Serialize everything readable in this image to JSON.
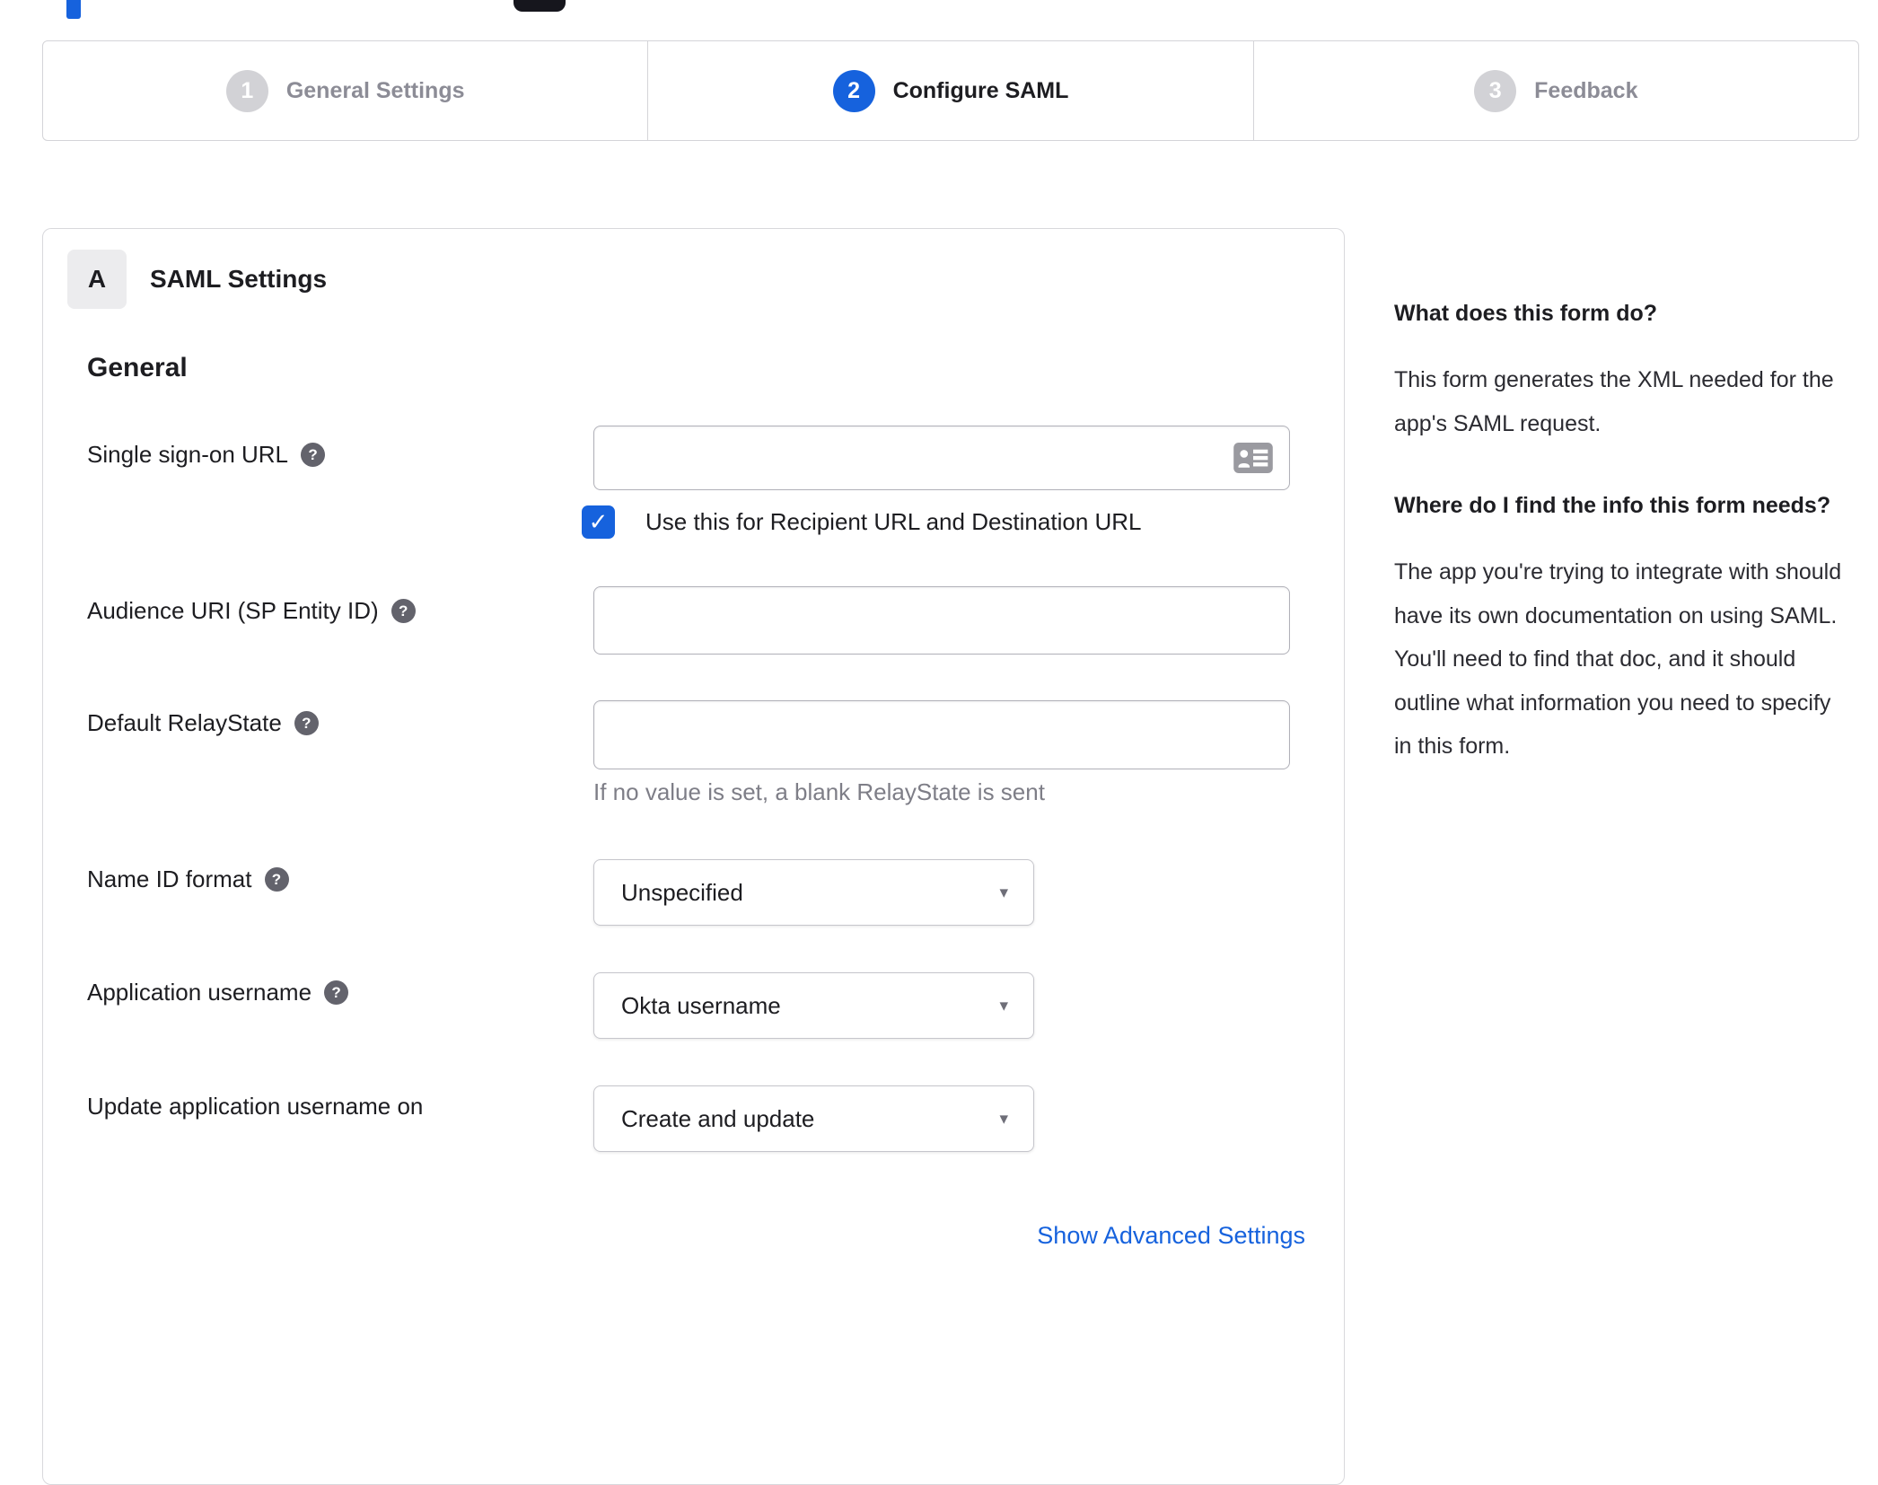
{
  "colors": {
    "accent": "#1662dd",
    "inactive_step_gray": "#d2d2d6",
    "muted_text": "#8c8c96"
  },
  "icons": {
    "help": "?",
    "check": "✓",
    "caret": "▾"
  },
  "stepper": {
    "steps": [
      {
        "number": "1",
        "label": "General Settings",
        "state": "inactive"
      },
      {
        "number": "2",
        "label": "Configure SAML",
        "state": "active"
      },
      {
        "number": "3",
        "label": "Feedback",
        "state": "inactive"
      }
    ]
  },
  "panel": {
    "section_letter": "A",
    "section_title": "SAML Settings",
    "group_heading": "General",
    "fields": {
      "sso": {
        "label": "Single sign-on URL",
        "value": "",
        "checkbox_label": "Use this for Recipient URL and Destination URL",
        "checkbox_checked": true
      },
      "audience": {
        "label": "Audience URI (SP Entity ID)",
        "value": ""
      },
      "relay": {
        "label": "Default RelayState",
        "value": "",
        "hint": "If no value is set, a blank RelayState is sent"
      },
      "nameid": {
        "label": "Name ID format",
        "value": "Unspecified"
      },
      "appuser": {
        "label": "Application username",
        "value": "Okta username"
      },
      "updateuser": {
        "label": "Update application username on",
        "value": "Create and update"
      }
    },
    "advanced_link": "Show Advanced Settings"
  },
  "sidebar": {
    "section1": {
      "heading": "What does this form do?",
      "body": "This form generates the XML needed for the app's SAML request."
    },
    "section2": {
      "heading": "Where do I find the info this form needs?",
      "body": "The app you're trying to integrate with should have its own documentation on using SAML. You'll need to find that doc, and it should outline what information you need to specify in this form."
    }
  }
}
